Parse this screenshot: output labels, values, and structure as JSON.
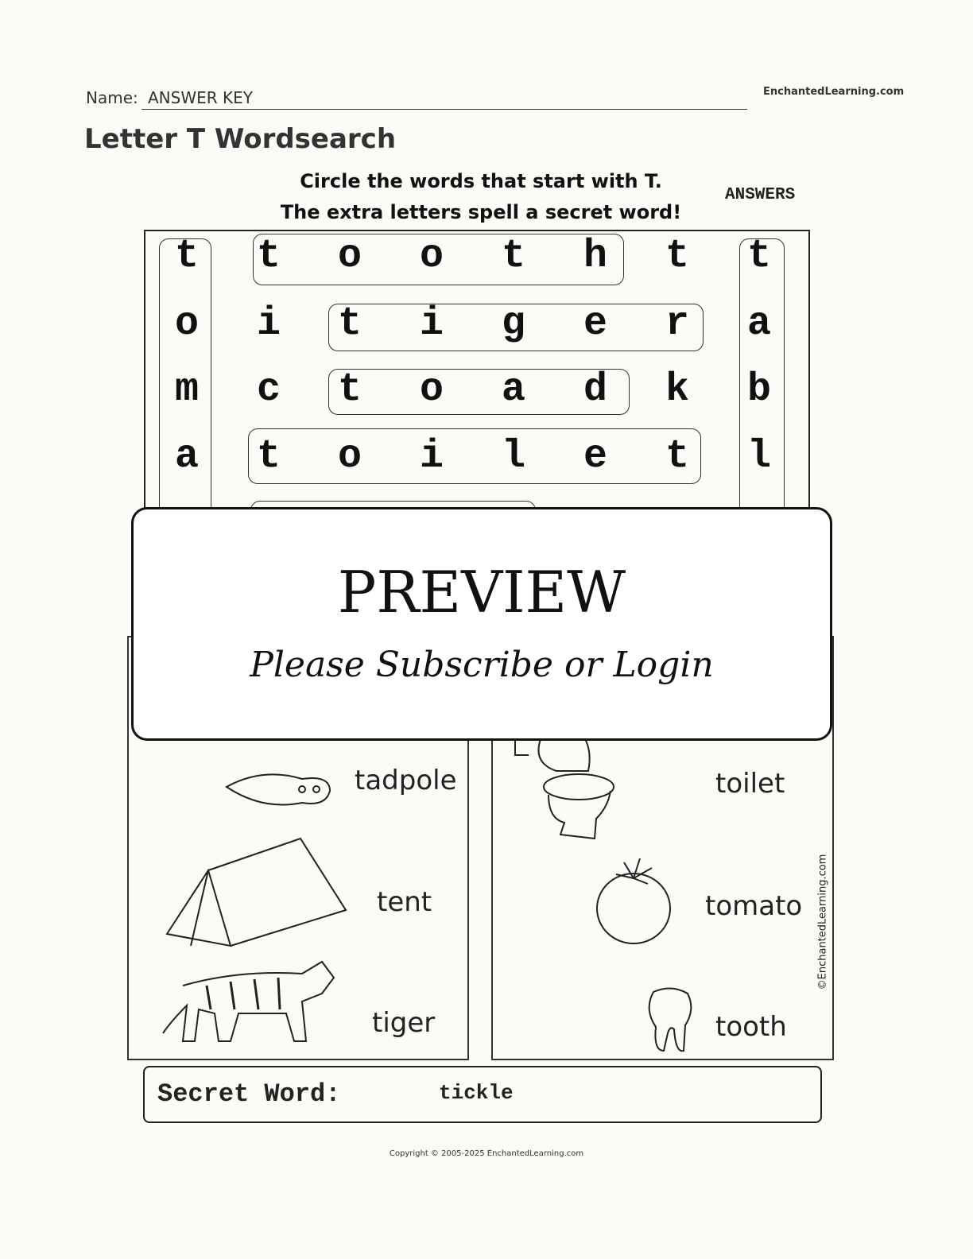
{
  "header": {
    "name_label": "Name:",
    "name_value": "ANSWER KEY",
    "site": "EnchantedLearning.com",
    "title": "Letter T Wordsearch"
  },
  "instructions": {
    "line1": "Circle the words that start with T.",
    "line2": "The extra letters spell a secret word!",
    "answers_label": "ANSWERS"
  },
  "grid": {
    "rows": [
      [
        "t",
        "t",
        "o",
        "o",
        "t",
        "h",
        "t",
        "t"
      ],
      [
        "o",
        "i",
        "t",
        "i",
        "g",
        "e",
        "r",
        "a"
      ],
      [
        "m",
        "c",
        "t",
        "o",
        "a",
        "d",
        "k",
        "b"
      ],
      [
        "a",
        "t",
        "o",
        "i",
        "l",
        "e",
        "t",
        "l"
      ]
    ],
    "circled_words": [
      "tooth",
      "tiger",
      "toad",
      "toilet",
      "tomato",
      "table"
    ]
  },
  "pictures": {
    "left": [
      "tadpole",
      "tent",
      "tiger"
    ],
    "right": [
      "toilet",
      "tomato",
      "tooth"
    ]
  },
  "preview": {
    "title": "PREVIEW",
    "subtitle": "Please Subscribe or Login"
  },
  "secret": {
    "label": "Secret Word:",
    "value": "tickle"
  },
  "credit_vertical": "©EnchantedLearning.com",
  "footer": {
    "copyright": "Copyright © 2005-2025 EnchantedLearning.com"
  }
}
